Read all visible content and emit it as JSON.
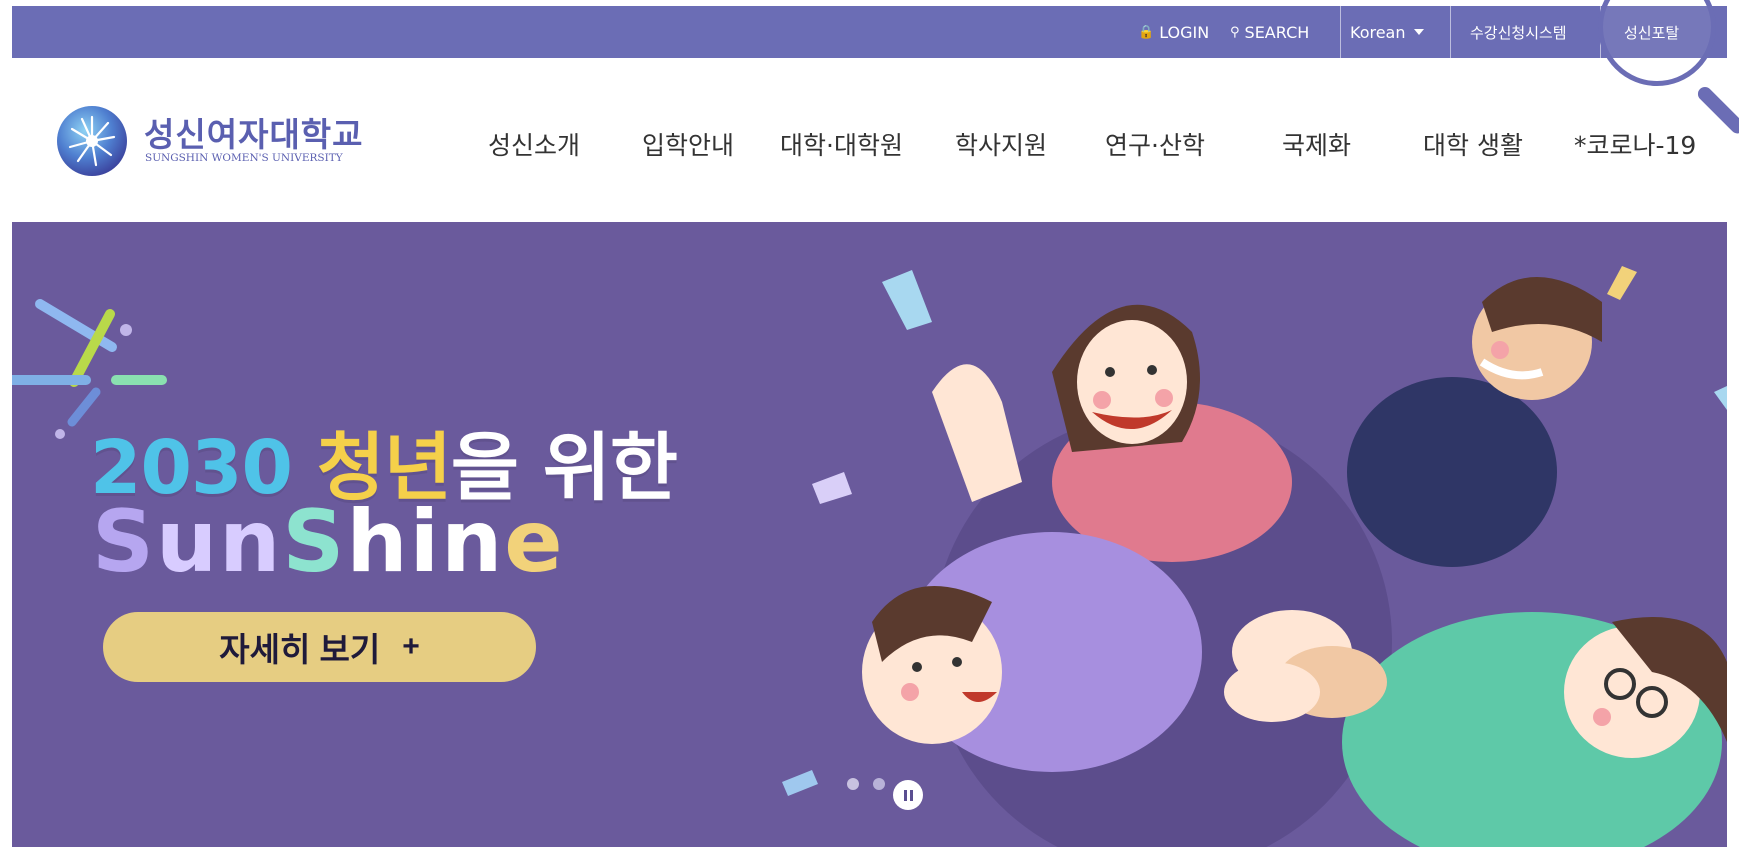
{
  "topbar": {
    "login": "LOGIN",
    "search": "SEARCH",
    "language": "Korean",
    "course_registration": "수강신청시스템",
    "portal": "성신포탈"
  },
  "header": {
    "logo_ko": "성신여자대학교",
    "logo_en": "SUNGSHIN WOMEN'S UNIVERSITY"
  },
  "nav": {
    "items": [
      "성신소개",
      "입학안내",
      "대학·대학원",
      "학사지원",
      "연구·산학",
      "국제화",
      "대학 생활",
      "*코로나-19"
    ]
  },
  "hero": {
    "headline_num": "2030",
    "headline_youth": "청년",
    "headline_rest": "을 위한",
    "sunshine": [
      "S",
      "un",
      "S",
      "hin",
      "e"
    ],
    "button_label": "자세히 보기",
    "button_plus": "+",
    "slides": 2
  },
  "colors": {
    "topbar": "#6b6db5",
    "hero_bg": "#6a5a9c",
    "button": "#e6cd82",
    "brand": "#5a5fb0"
  },
  "icons": [
    "lock-icon",
    "search-icon",
    "caret-down-icon",
    "pause-icon",
    "magnifier-icon"
  ]
}
